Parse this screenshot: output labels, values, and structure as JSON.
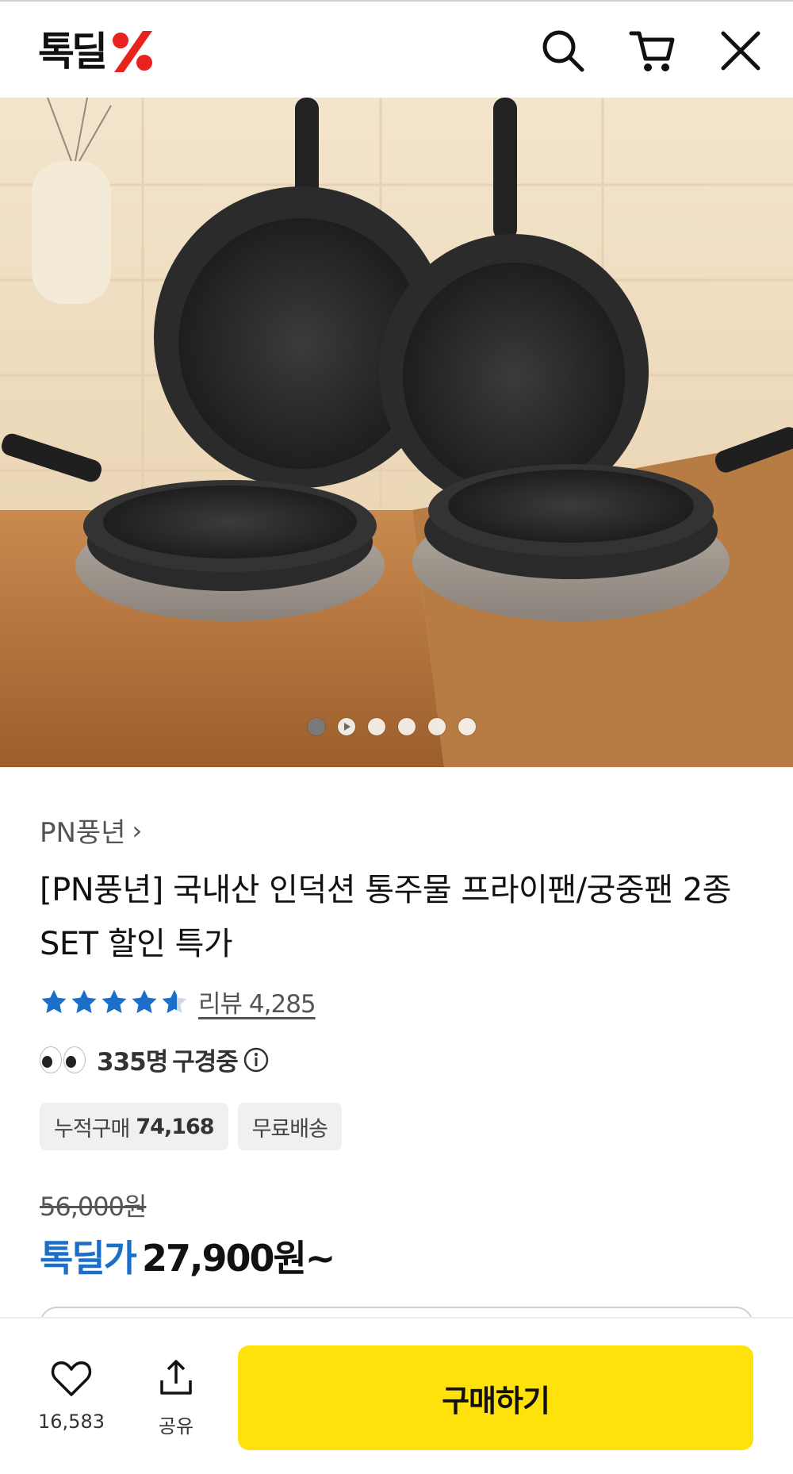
{
  "header": {
    "logo_text": "톡딜",
    "search_icon": "search-icon",
    "cart_icon": "cart-icon",
    "close_icon": "close-icon"
  },
  "hero": {
    "image_description": "frying pans set",
    "carousel": {
      "count": 6,
      "active_index": 0,
      "play_index": 1
    }
  },
  "product": {
    "brand": "PN풍년",
    "title": "[PN풍년] 국내산 인덕션 통주물 프라이팬/궁중팬 2종 SET 할인 특가",
    "rating_stars": 4.5,
    "review_label": "리뷰 4,285",
    "viewers_count": "335명",
    "viewers_label": "구경중",
    "tags": [
      {
        "label": "누적구매",
        "value": "74,168"
      },
      {
        "label": "무료배송",
        "value": ""
      }
    ],
    "original_price": "56,000원",
    "sale_label": "톡딜가",
    "sale_price": "27,900원~"
  },
  "bottom_bar": {
    "like_count": "16,583",
    "share_label": "공유",
    "buy_label": "구매하기"
  },
  "colors": {
    "accent_blue": "#1c6fc9",
    "buy_yellow": "#ffe20b",
    "logo_red": "#e8231e",
    "star_blue": "#1c6fc9"
  }
}
